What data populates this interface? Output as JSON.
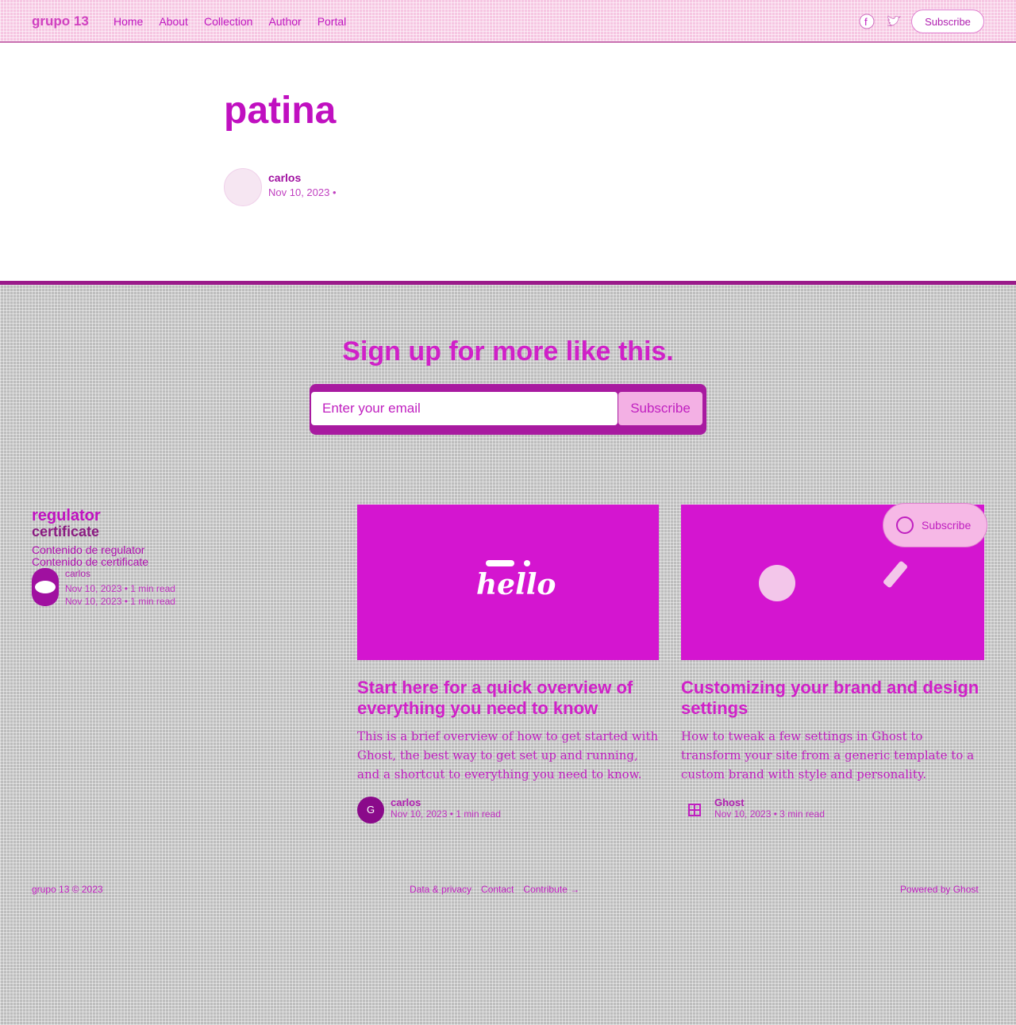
{
  "header": {
    "brand": "grupo 13",
    "nav": [
      "Home",
      "About",
      "Collection",
      "Author",
      "Portal"
    ],
    "subscribe_label": "Subscribe"
  },
  "post": {
    "title": "patina",
    "author": "carlos",
    "date": "Nov 10, 2023"
  },
  "cta": {
    "title": "Sign up for more like this.",
    "placeholder": "Enter your email",
    "button": "Subscribe"
  },
  "side_card": {
    "title": "regulator",
    "subtitle": "certificate",
    "excerpt1": "Contenido de regulator",
    "excerpt2": "Contenido de certificate",
    "author": "carlos",
    "meta1": "Nov 10, 2023 • 1 min read",
    "meta2": "Nov 10, 2023 • 1 min read"
  },
  "cards": [
    {
      "title": "Start here for a quick overview of everything you need to know",
      "excerpt": "This is a brief overview of how to get started with Ghost, the best way to get set up and running, and a shortcut to everything you need to know.",
      "author": "carlos",
      "avatar_label": "G",
      "meta": "Nov 10, 2023 • 1 min read",
      "logo": "hello"
    },
    {
      "title": "Customizing your brand and design settings",
      "excerpt": "How to tweak a few settings in Ghost to transform your site from a generic template to a custom brand with style and personality.",
      "author": "Ghost",
      "meta": "Nov 10, 2023 • 3 min read"
    }
  ],
  "portal": {
    "label": "Subscribe"
  },
  "footer": {
    "copyright": "grupo 13 © 2023",
    "links": [
      "Data & privacy",
      "Contact",
      "Contribute →"
    ],
    "powered": "Powered by Ghost"
  }
}
